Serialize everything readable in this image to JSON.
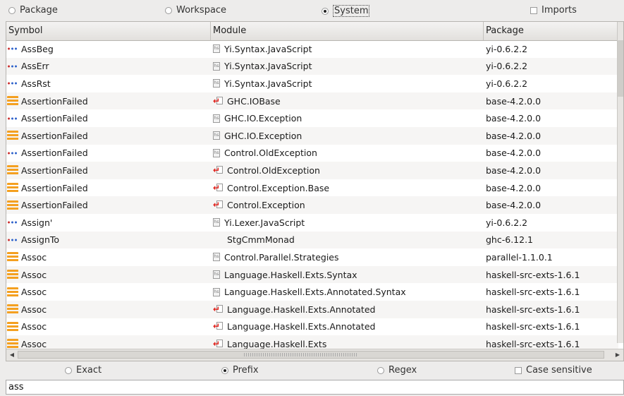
{
  "scope": {
    "package": "Package",
    "workspace": "Workspace",
    "system": "System",
    "imports": "Imports"
  },
  "columns": {
    "symbol": "Symbol",
    "module": "Module",
    "package": "Package"
  },
  "rows": [
    {
      "symbol": "AssBeg",
      "sym_icon": "constructor-icon",
      "module": "Yi.Syntax.JavaScript",
      "mod_icon": "haskell-file-icon",
      "package": "yi-0.6.2.2"
    },
    {
      "symbol": "AssErr",
      "sym_icon": "constructor-icon",
      "module": "Yi.Syntax.JavaScript",
      "mod_icon": "haskell-file-icon",
      "package": "yi-0.6.2.2"
    },
    {
      "symbol": "AssRst",
      "sym_icon": "constructor-icon",
      "module": "Yi.Syntax.JavaScript",
      "mod_icon": "haskell-file-icon",
      "package": "yi-0.6.2.2"
    },
    {
      "symbol": "AssertionFailed",
      "sym_icon": "type-icon",
      "module": "GHC.IOBase",
      "mod_icon": "source-link-icon",
      "package": "base-4.2.0.0"
    },
    {
      "symbol": "AssertionFailed",
      "sym_icon": "constructor-icon",
      "module": "GHC.IO.Exception",
      "mod_icon": "haskell-file-icon",
      "package": "base-4.2.0.0"
    },
    {
      "symbol": "AssertionFailed",
      "sym_icon": "type-icon",
      "module": "GHC.IO.Exception",
      "mod_icon": "haskell-file-icon",
      "package": "base-4.2.0.0"
    },
    {
      "symbol": "AssertionFailed",
      "sym_icon": "constructor-icon",
      "module": "Control.OldException",
      "mod_icon": "haskell-file-icon",
      "package": "base-4.2.0.0"
    },
    {
      "symbol": "AssertionFailed",
      "sym_icon": "type-icon",
      "module": "Control.OldException",
      "mod_icon": "source-link-icon",
      "package": "base-4.2.0.0"
    },
    {
      "symbol": "AssertionFailed",
      "sym_icon": "type-icon",
      "module": "Control.Exception.Base",
      "mod_icon": "source-link-icon",
      "package": "base-4.2.0.0"
    },
    {
      "symbol": "AssertionFailed",
      "sym_icon": "type-icon",
      "module": "Control.Exception",
      "mod_icon": "source-link-icon",
      "package": "base-4.2.0.0"
    },
    {
      "symbol": "Assign'",
      "sym_icon": "constructor-icon",
      "module": "Yi.Lexer.JavaScript",
      "mod_icon": "haskell-file-icon",
      "package": "yi-0.6.2.2"
    },
    {
      "symbol": "AssignTo",
      "sym_icon": "constructor-icon",
      "module": "StgCmmMonad",
      "mod_icon": "none",
      "package": "ghc-6.12.1"
    },
    {
      "symbol": "Assoc",
      "sym_icon": "type-icon",
      "module": "Control.Parallel.Strategies",
      "mod_icon": "haskell-file-icon",
      "package": "parallel-1.1.0.1"
    },
    {
      "symbol": "Assoc",
      "sym_icon": "type-icon",
      "module": "Language.Haskell.Exts.Syntax",
      "mod_icon": "haskell-file-icon",
      "package": "haskell-src-exts-1.6.1"
    },
    {
      "symbol": "Assoc",
      "sym_icon": "type-icon",
      "module": "Language.Haskell.Exts.Annotated.Syntax",
      "mod_icon": "haskell-file-icon",
      "package": "haskell-src-exts-1.6.1"
    },
    {
      "symbol": "Assoc",
      "sym_icon": "type-icon",
      "module": "Language.Haskell.Exts.Annotated",
      "mod_icon": "source-link-icon",
      "package": "haskell-src-exts-1.6.1"
    },
    {
      "symbol": "Assoc",
      "sym_icon": "type-icon",
      "module": "Language.Haskell.Exts.Annotated",
      "mod_icon": "source-link-icon",
      "package": "haskell-src-exts-1.6.1"
    },
    {
      "symbol": "Assoc",
      "sym_icon": "type-icon",
      "module": "Language.Haskell.Exts",
      "mod_icon": "source-link-icon",
      "package": "haskell-src-exts-1.6.1"
    }
  ],
  "modes": {
    "exact": "Exact",
    "prefix": "Prefix",
    "regex": "Regex",
    "case_sensitive": "Case sensitive"
  },
  "search": {
    "value": "ass"
  }
}
